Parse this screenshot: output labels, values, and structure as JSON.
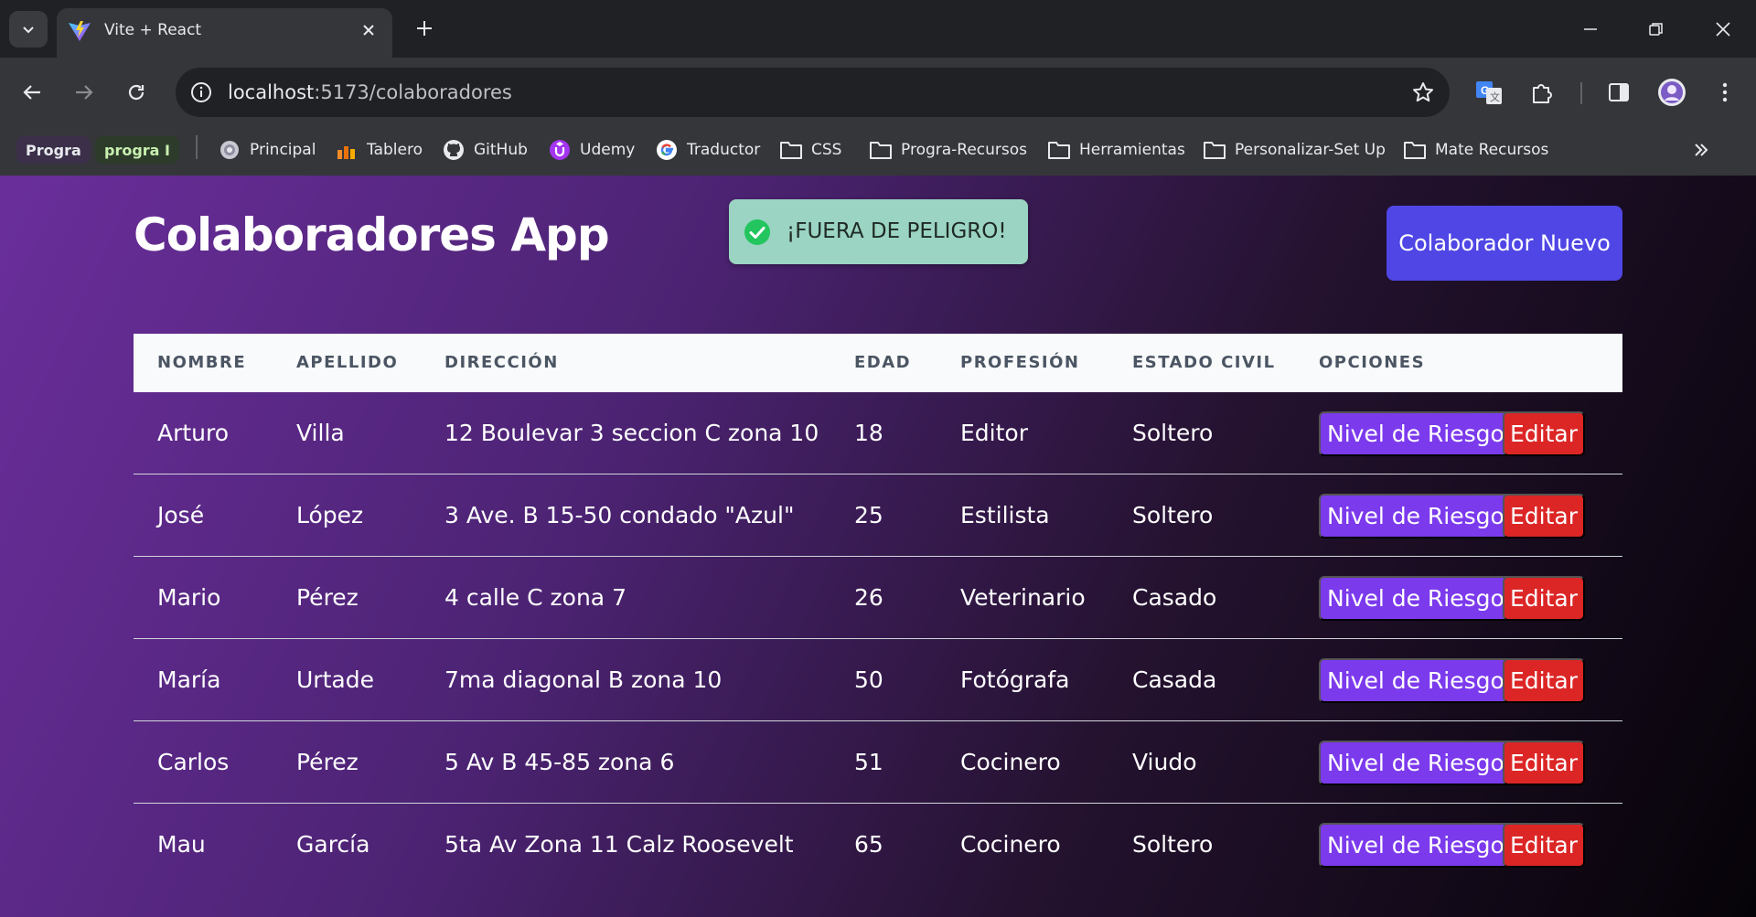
{
  "browser": {
    "tab_title": "Vite + React",
    "url_host": "localhost",
    "url_path": ":5173/colaboradores"
  },
  "bookmarks": [
    {
      "label": "Progra",
      "kind": "chip",
      "bg": "#3b2f4a",
      "fg": "#e8eaed"
    },
    {
      "label": "progra I",
      "kind": "chip",
      "bg": "#2d3b2a",
      "fg": "#c8f0b0"
    },
    {
      "label": "Principal",
      "icon": "globe-icon"
    },
    {
      "label": "Tablero",
      "icon": "tablero-icon"
    },
    {
      "label": "GitHub",
      "icon": "github-icon"
    },
    {
      "label": "Udemy",
      "icon": "udemy-icon"
    },
    {
      "label": "Traductor",
      "icon": "google-icon"
    },
    {
      "label": "CSS",
      "icon": "folder-icon"
    },
    {
      "label": "Progra-Recursos",
      "icon": "folder-icon"
    },
    {
      "label": "Herramientas",
      "icon": "folder-icon"
    },
    {
      "label": "Personalizar-Set Up",
      "icon": "folder-icon"
    },
    {
      "label": "Mate Recursos",
      "icon": "folder-icon"
    }
  ],
  "app": {
    "title": "Colaboradores App",
    "toast": "¡FUERA DE PELIGRO!",
    "new_button": "Colaborador Nuevo"
  },
  "table": {
    "headers": [
      "NOMBRE",
      "APELLIDO",
      "DIRECCIÓN",
      "EDAD",
      "PROFESIÓN",
      "ESTADO CIVIL",
      "OPCIONES"
    ],
    "rows": [
      [
        "Arturo",
        "Villa",
        "12 Boulevar 3 seccion C zona 10",
        "18",
        "Editor",
        "Soltero"
      ],
      [
        "José",
        "López",
        "3 Ave. B 15-50 condado \"Azul\"",
        "25",
        "Estilista",
        "Soltero"
      ],
      [
        "Mario",
        "Pérez",
        "4 calle C zona 7",
        "26",
        "Veterinario",
        "Casado"
      ],
      [
        "María",
        "Urtade",
        "7ma diagonal B zona 10",
        "50",
        "Fotógrafa",
        "Casada"
      ],
      [
        "Carlos",
        "Pérez",
        "5 Av B 45-85 zona 6",
        "51",
        "Cocinero",
        "Viudo"
      ],
      [
        "Mau",
        "García",
        "5ta Av Zona 11 Calz Roosevelt",
        "65",
        "Cocinero",
        "Soltero"
      ]
    ],
    "risk_button": "Nivel de Riesgo",
    "edit_button": "Editar"
  },
  "colors": {
    "accent_indigo": "#4f46e5",
    "risk_purple": "#7c3aed",
    "edit_red": "#dc2626",
    "toast_green": "#9bd4c2"
  }
}
